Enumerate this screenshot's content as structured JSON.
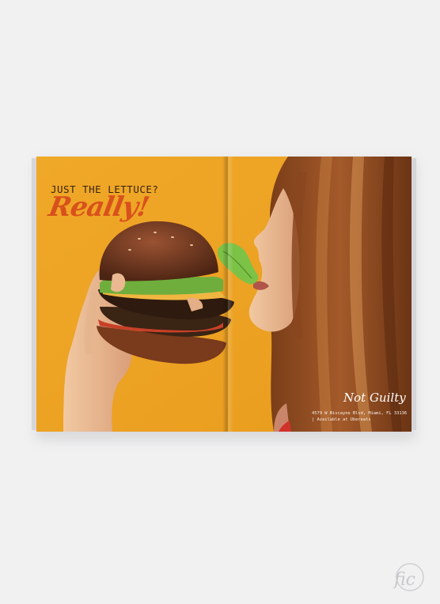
{
  "ad": {
    "headline": "JUST THE LETTUCE?",
    "script_text": "Really!",
    "brand": "Not Guilty",
    "address_line_1": "4579 W Biscayne Blvd, Miami, FL 33136",
    "address_line_2": "| Available at Ubereats"
  },
  "watermark": {
    "text": "fic"
  },
  "colors": {
    "background": "#f1f1f2",
    "spread_orange": "#eea323",
    "script_accent": "#d8511c"
  }
}
